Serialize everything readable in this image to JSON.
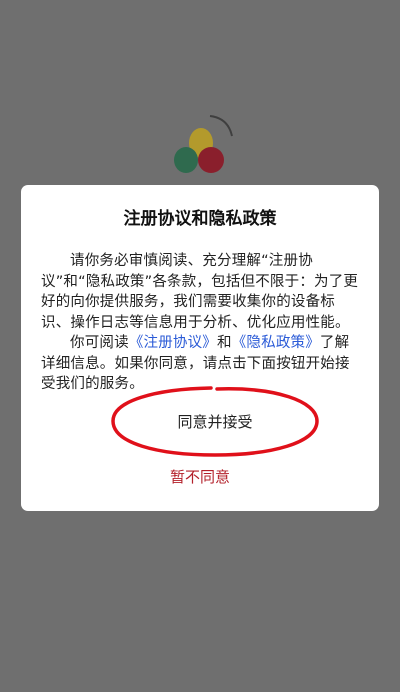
{
  "dialog": {
    "title": "注册协议和隐私政策",
    "paragraph1": "请你务必审慎阅读、充分理解“注册协议”和“隐私政策”各条款，包括但不限于：为了更好的向你提供服务，我们需要收集你的设备标识、操作日志等信息用于分析、优化应用性能。",
    "paragraph2_prefix": "你可阅读",
    "link_register": "《注册协议》",
    "paragraph2_and": "和",
    "link_privacy": "《隐私政策》",
    "paragraph2_suffix": "了解详细信息。如果你同意，请点击下面按钮开始接受我们的服务。",
    "agree_label": "同意并接受",
    "decline_label": "暂不同意"
  },
  "colors": {
    "overlay": "#6f6f6f",
    "dialog_bg": "#ffffff",
    "link": "#2b5bd7",
    "decline": "#b3202a",
    "annotation_ellipse": "#e0101a"
  },
  "icons": {
    "backdrop_logo": "colored-eggs-logo-icon"
  }
}
